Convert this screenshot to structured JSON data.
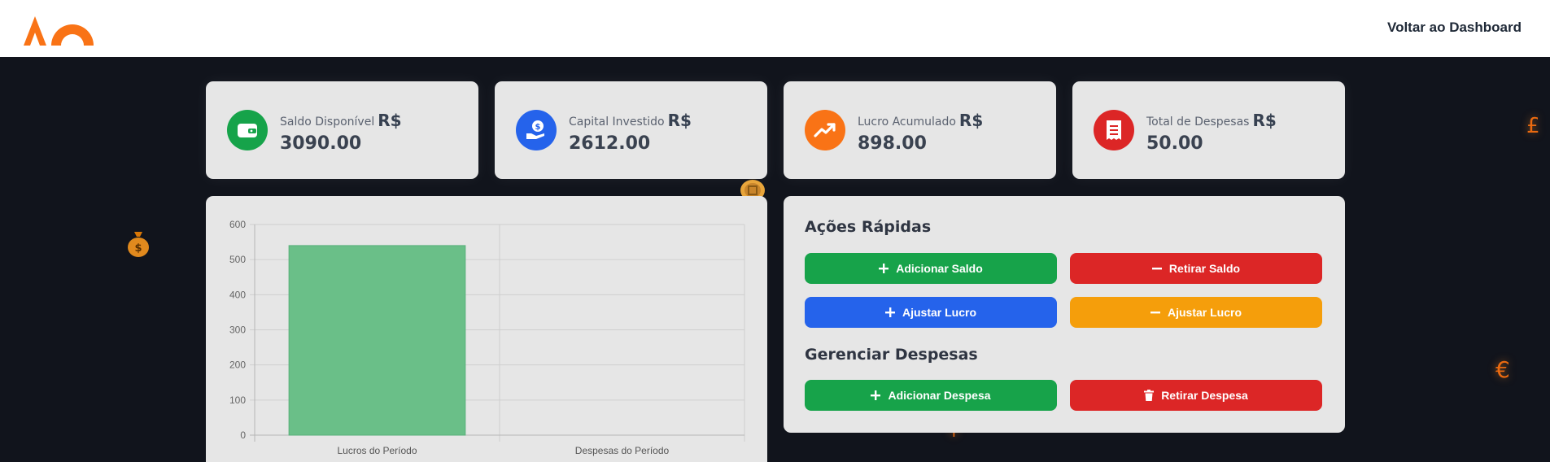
{
  "header": {
    "back_label": "Voltar ao Dashboard",
    "logo_icon": "brand-logo",
    "brand_color": "#f97316"
  },
  "stats": [
    {
      "label": "Saldo Disponível",
      "currency": "R$",
      "value": "3090.00",
      "icon": "wallet-icon",
      "color": "#16a34a"
    },
    {
      "label": "Capital Investido",
      "currency": "R$",
      "value": "2612.00",
      "icon": "hand-coin-icon",
      "color": "#2563eb"
    },
    {
      "label": "Lucro Acumulado",
      "currency": "R$",
      "value": "898.00",
      "icon": "trending-up-icon",
      "color": "#f97316"
    },
    {
      "label": "Total de Despesas",
      "currency": "R$",
      "value": "50.00",
      "icon": "receipt-icon",
      "color": "#dc2626"
    }
  ],
  "chart_data": {
    "type": "bar",
    "categories": [
      "Lucros do Período",
      "Despesas do Período"
    ],
    "values": [
      540,
      0
    ],
    "ylim": [
      0,
      600
    ],
    "yticks": [
      "0",
      "100",
      "200",
      "300",
      "400",
      "500",
      "600"
    ],
    "bar_color": "#6abf88",
    "grid": true
  },
  "quick_actions": {
    "title": "Ações Rápidas",
    "add_balance": "Adicionar Saldo",
    "withdraw_balance": "Retirar Saldo",
    "adjust_profit_up": "Ajustar Lucro",
    "adjust_profit_down": "Ajustar Lucro"
  },
  "expenses": {
    "title": "Gerenciar Despesas",
    "add_expense": "Adicionar Despesa",
    "remove_expense": "Retirar Despesa"
  },
  "decor": {
    "pound": "£",
    "euro": "€",
    "plus": "+"
  }
}
